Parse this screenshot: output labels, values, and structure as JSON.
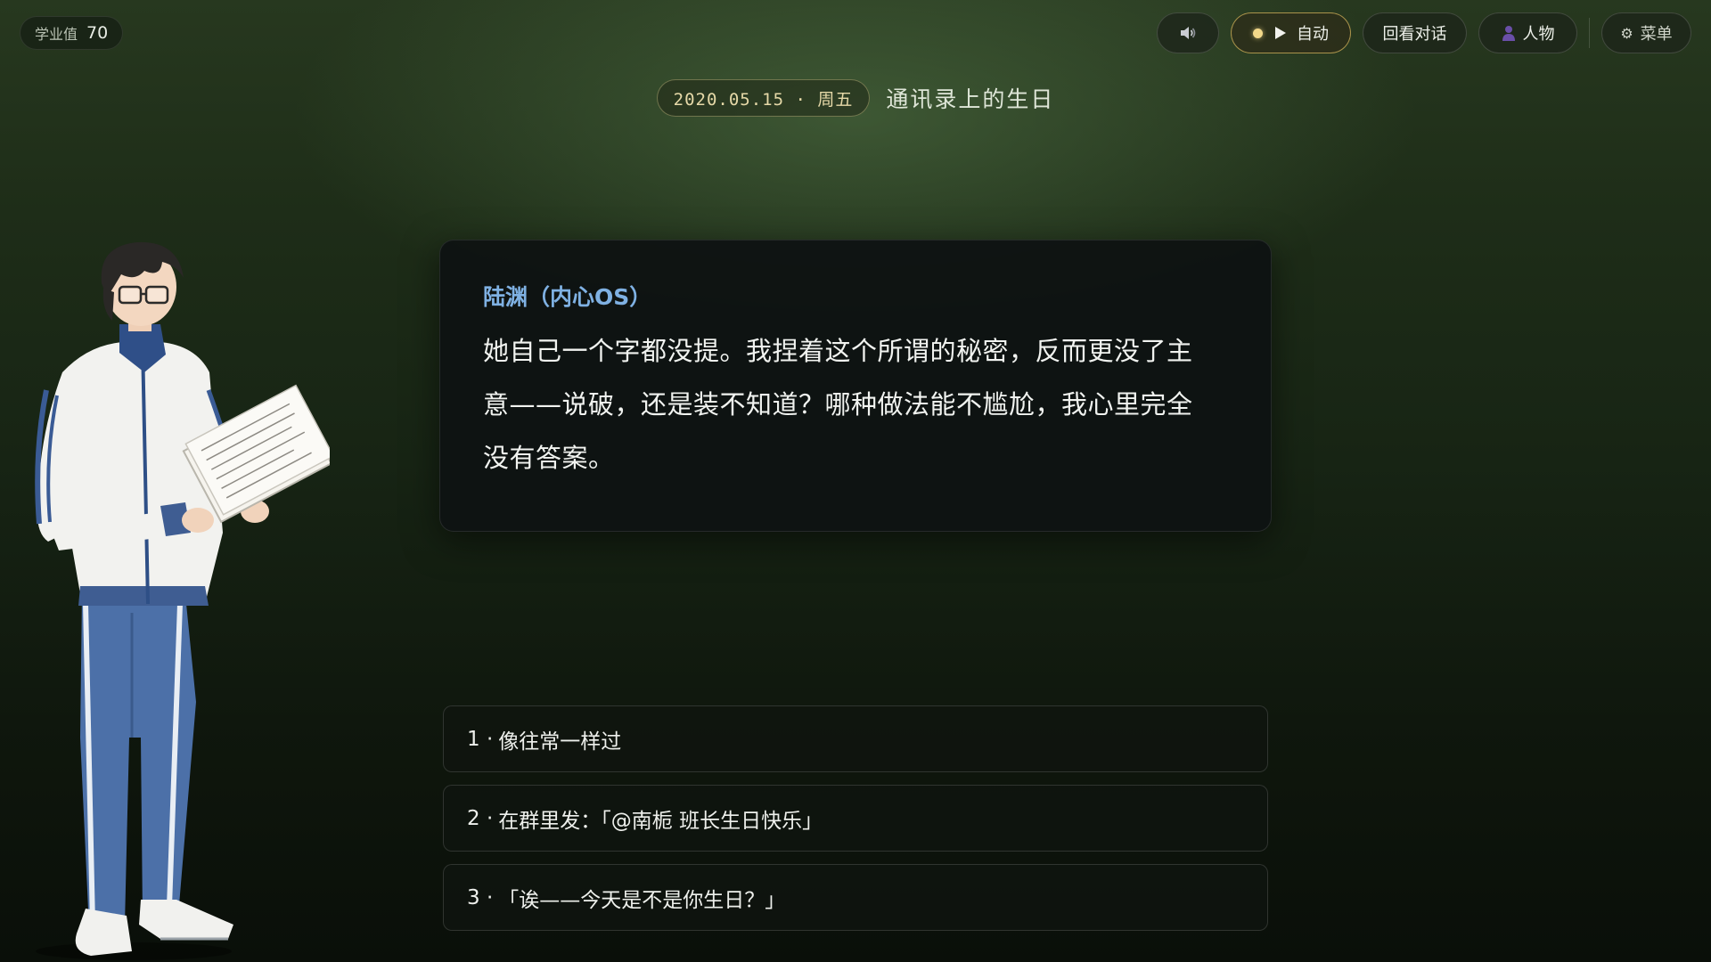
{
  "hud": {
    "score_label": "学业值",
    "score_value": "70"
  },
  "toolbar": {
    "sound_icon": "speaker-icon",
    "auto_label": "自动",
    "review_label": "回看对话",
    "people_label": "人物",
    "menu_label": "菜单"
  },
  "chapter": {
    "date": "2020.05.15 · 周五",
    "title": "通讯录上的生日"
  },
  "dialog": {
    "speaker": "陆渊（内心OS）",
    "lines": [
      "她自己一个字都没提。我捏着这个所谓的秘密，反而更没了主",
      "意——说破，还是装不知道？哪种做法能不尴尬，我心里完全",
      "没有答案。"
    ]
  },
  "choices": [
    {
      "num": "1 ·",
      "text": "像往常一样过"
    },
    {
      "num": "2 ·",
      "text": "在群里发：「@南栀 班长生日快乐」"
    },
    {
      "num": "3 ·",
      "text": "「诶——今天是不是你生日？」"
    }
  ],
  "colors": {
    "speaker": "#7fb1e3",
    "auto_border": "#d6b65c",
    "date_text": "#e6d9a8"
  }
}
